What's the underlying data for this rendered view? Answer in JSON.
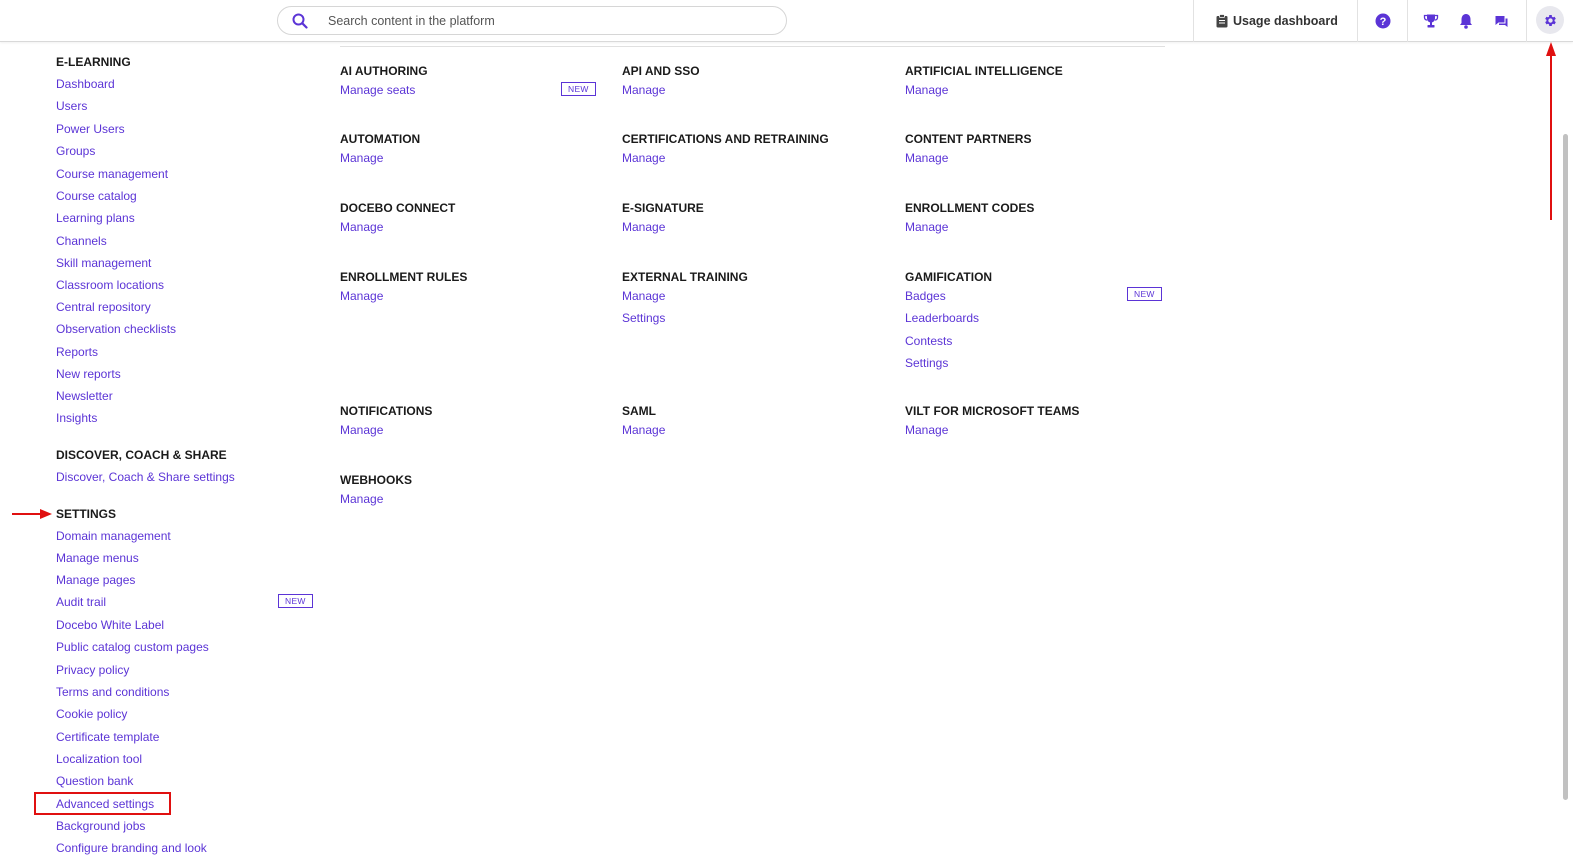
{
  "topbar": {
    "search_placeholder": "Search content in the platform",
    "usage_label": "Usage dashboard",
    "icons": [
      "search-icon",
      "clipboard-icon",
      "help-icon",
      "trophy-icon",
      "bell-icon",
      "chat-icon",
      "gear-icon"
    ],
    "accent": "#5b34d6"
  },
  "left": {
    "elearning": {
      "title": "E-LEARNING",
      "items": [
        "Dashboard",
        "Users",
        "Power Users",
        "Groups",
        "Course management",
        "Course catalog",
        "Learning plans",
        "Channels",
        "Skill management",
        "Classroom locations",
        "Central repository",
        "Observation checklists",
        "Reports",
        "New reports",
        "Newsletter",
        "Insights"
      ]
    },
    "discover": {
      "title": "DISCOVER, COACH & SHARE",
      "items": [
        "Discover, Coach & Share settings"
      ]
    },
    "settings": {
      "title": "SETTINGS",
      "items": [
        "Domain management",
        "Manage menus",
        "Manage pages",
        "Audit trail",
        "Docebo White Label",
        "Public catalog custom pages",
        "Privacy policy",
        "Terms and conditions",
        "Cookie policy",
        "Certificate template",
        "Localization tool",
        "Question bank",
        "Advanced settings",
        "Background jobs",
        "Configure branding and look"
      ],
      "new_badge": "NEW"
    }
  },
  "apps": {
    "new_badge": "NEW",
    "ai_authoring": {
      "title": "AI AUTHORING",
      "links": [
        "Manage seats"
      ]
    },
    "api_sso": {
      "title": "API AND SSO",
      "links": [
        "Manage"
      ]
    },
    "artificial_intelligence": {
      "title": "ARTIFICIAL INTELLIGENCE",
      "links": [
        "Manage"
      ]
    },
    "automation": {
      "title": "AUTOMATION",
      "links": [
        "Manage"
      ]
    },
    "certifications": {
      "title": "CERTIFICATIONS AND RETRAINING",
      "links": [
        "Manage"
      ]
    },
    "content_partners": {
      "title": "CONTENT PARTNERS",
      "links": [
        "Manage"
      ]
    },
    "docebo_connect": {
      "title": "DOCEBO CONNECT",
      "links": [
        "Manage"
      ]
    },
    "esignature": {
      "title": "E-SIGNATURE",
      "links": [
        "Manage"
      ]
    },
    "enrollment_codes": {
      "title": "ENROLLMENT CODES",
      "links": [
        "Manage"
      ]
    },
    "enrollment_rules": {
      "title": "ENROLLMENT RULES",
      "links": [
        "Manage"
      ]
    },
    "external_training": {
      "title": "EXTERNAL TRAINING",
      "links": [
        "Manage",
        "Settings"
      ]
    },
    "gamification": {
      "title": "GAMIFICATION",
      "links": [
        "Badges",
        "Leaderboards",
        "Contests",
        "Settings"
      ]
    },
    "notifications": {
      "title": "NOTIFICATIONS",
      "links": [
        "Manage"
      ]
    },
    "saml": {
      "title": "SAML",
      "links": [
        "Manage"
      ]
    },
    "vilt_teams": {
      "title": "VILT FOR MICROSOFT TEAMS",
      "links": [
        "Manage"
      ]
    },
    "webhooks": {
      "title": "WEBHOOKS",
      "links": [
        "Manage"
      ]
    }
  }
}
